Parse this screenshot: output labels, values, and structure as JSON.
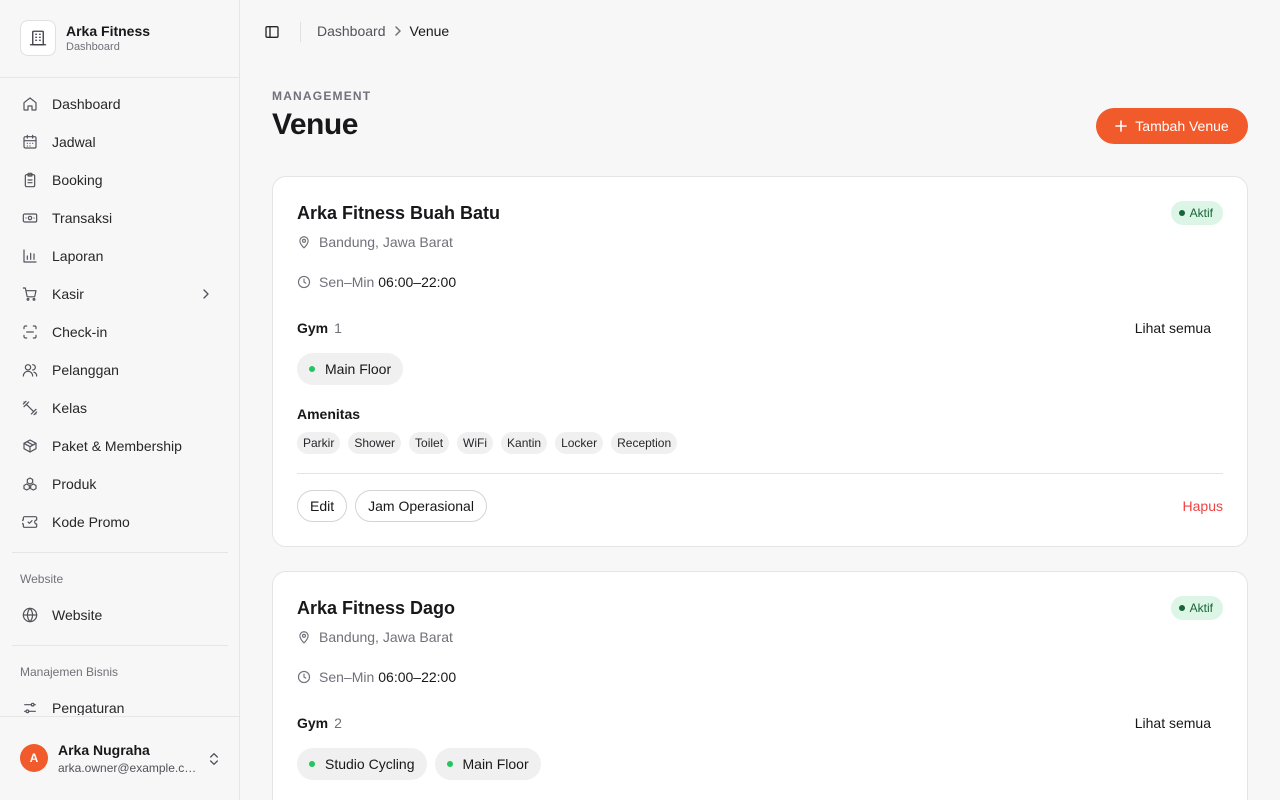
{
  "brand": {
    "name": "Arka Fitness",
    "subtitle": "Dashboard"
  },
  "sidebar": {
    "items": [
      {
        "label": "Dashboard",
        "icon": "home-icon"
      },
      {
        "label": "Jadwal",
        "icon": "calendar-icon"
      },
      {
        "label": "Booking",
        "icon": "clipboard-icon"
      },
      {
        "label": "Transaksi",
        "icon": "banknote-icon"
      },
      {
        "label": "Laporan",
        "icon": "bar-chart-icon"
      },
      {
        "label": "Kasir",
        "icon": "cart-icon"
      },
      {
        "label": "Check-in",
        "icon": "scan-icon"
      },
      {
        "label": "Pelanggan",
        "icon": "users-icon"
      },
      {
        "label": "Kelas",
        "icon": "dumbbell-icon"
      },
      {
        "label": "Paket & Membership",
        "icon": "package-icon"
      },
      {
        "label": "Produk",
        "icon": "boxes-icon"
      },
      {
        "label": "Kode Promo",
        "icon": "ticket-icon"
      }
    ],
    "website_section": "Website",
    "website_item": "Website",
    "business_section": "Manajemen Bisnis",
    "business_item": "Pengaturan"
  },
  "user": {
    "initial": "A",
    "name": "Arka Nugraha",
    "email": "arka.owner@example.com"
  },
  "breadcrumb": {
    "parent": "Dashboard",
    "current": "Venue"
  },
  "header": {
    "eyebrow": "MANAGEMENT",
    "title": "Venue",
    "add_label": "Tambah Venue"
  },
  "labels": {
    "gym": "Gym",
    "see_all": "Lihat semua",
    "amenities": "Amenitas",
    "edit": "Edit",
    "hours_button": "Jam Operasional",
    "delete": "Hapus",
    "days": "Sen–Min"
  },
  "venues": [
    {
      "name": "Arka Fitness Buah Batu",
      "status": "Aktif",
      "location": "Bandung, Jawa Barat",
      "hours": "06:00–22:00",
      "gym_count": "1",
      "gyms": [
        "Main Floor"
      ],
      "amenities": [
        "Parkir",
        "Shower",
        "Toilet",
        "WiFi",
        "Kantin",
        "Locker",
        "Reception"
      ]
    },
    {
      "name": "Arka Fitness Dago",
      "status": "Aktif",
      "location": "Bandung, Jawa Barat",
      "hours": "06:00–22:00",
      "gym_count": "2",
      "gyms": [
        "Studio Cycling",
        "Main Floor"
      ]
    }
  ],
  "colors": {
    "accent": "#f15a2b",
    "success": "#22c55e",
    "danger": "#ef4444"
  }
}
